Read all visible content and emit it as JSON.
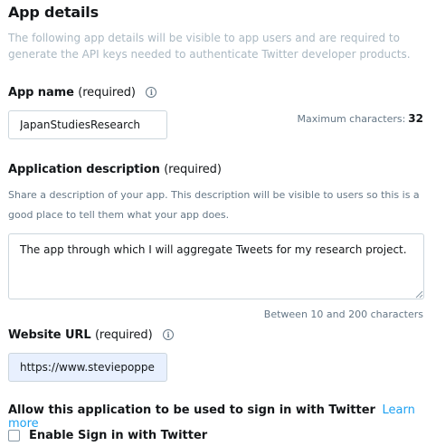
{
  "section": {
    "title": "App details",
    "description": "The following app details will be visible to app users and are required to generate the API keys needed to authenticate Twitter developer products."
  },
  "app_name": {
    "label": "App name",
    "required": "(required)",
    "value": "JapanStudiesResearch",
    "max_label": "Maximum characters:",
    "max_value": "32"
  },
  "app_description": {
    "label": "Application description",
    "required": "(required)",
    "help": "Share a description of your app. This description will be visible to users so this is a good place to tell them what your app does.",
    "value": "The app through which I will aggregate Tweets for my research project.",
    "length_hint": "Between 10 and 200 characters"
  },
  "website": {
    "label": "Website URL",
    "required": "(required)",
    "value": "https://www.steviepoppe"
  },
  "signin": {
    "label": "Allow this application to be used to sign in with Twitter",
    "learn_more": "Learn more",
    "checkbox_label": "Enable Sign in with Twitter",
    "checked": false
  },
  "colors": {
    "link": "#1da1f2",
    "muted": "#aab8c2",
    "secondary": "#657786",
    "autofill_bg": "#e8f0fe"
  }
}
